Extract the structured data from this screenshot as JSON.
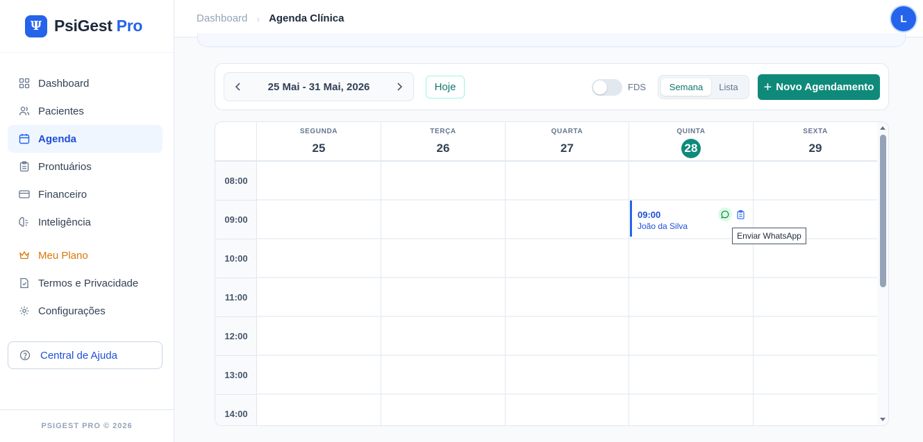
{
  "brand": {
    "name": "PsiGest",
    "suffix": "Pro",
    "logo_glyph": "Ψ",
    "accent": "#2563eb"
  },
  "nav": [
    {
      "label": "Dashboard",
      "icon": "grid-icon",
      "active": false
    },
    {
      "label": "Pacientes",
      "icon": "users-icon",
      "active": false
    },
    {
      "label": "Agenda",
      "icon": "calendar-icon",
      "active": true
    },
    {
      "label": "Prontuários",
      "icon": "clipboard-icon",
      "active": false
    },
    {
      "label": "Financeiro",
      "icon": "card-icon",
      "active": false
    },
    {
      "label": "Inteligência",
      "icon": "brain-icon",
      "active": false
    }
  ],
  "nav_secondary": [
    {
      "label": "Meu Plano",
      "icon": "crown-icon",
      "color": "#d97706"
    },
    {
      "label": "Termos e Privacidade",
      "icon": "document-icon"
    },
    {
      "label": "Configurações",
      "icon": "gear-icon"
    }
  ],
  "help": {
    "label": "Central de Ajuda",
    "icon": "help-circle-icon"
  },
  "footer": {
    "text": "PSIGEST PRO © 2026"
  },
  "topbar": {
    "breadcrumb_root": "Dashboard",
    "breadcrumb_sep": "›",
    "breadcrumb_current": "Agenda Clínica",
    "avatar_initial": "L"
  },
  "toolbar": {
    "date_range": "25 Mai - 31 Mai, 2026",
    "today_label": "Hoje",
    "weekend_toggle_label": "FDS",
    "weekend_toggle_on": false,
    "view_week": "Semana",
    "view_list": "Lista",
    "active_view": "Semana",
    "new_button_label": "Novo Agendamento",
    "new_button_color": "#0f8a7a"
  },
  "calendar": {
    "days": [
      {
        "name": "SEGUNDA",
        "num": "25",
        "today": false
      },
      {
        "name": "TERÇA",
        "num": "26",
        "today": false
      },
      {
        "name": "QUARTA",
        "num": "27",
        "today": false
      },
      {
        "name": "QUINTA",
        "num": "28",
        "today": true
      },
      {
        "name": "SEXTA",
        "num": "29",
        "today": false
      }
    ],
    "times": [
      "08:00",
      "09:00",
      "10:00",
      "11:00",
      "12:00",
      "13:00",
      "14:00"
    ],
    "appointment": {
      "time": "09:00",
      "patient": "João da Silva",
      "day": "QUINTA"
    },
    "tooltip": "Enviar WhatsApp"
  }
}
